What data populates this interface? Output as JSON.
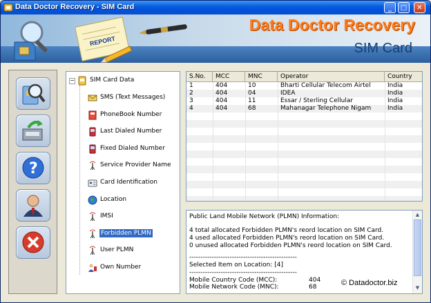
{
  "window": {
    "title": "Data Doctor Recovery - SIM Card",
    "controls": {
      "minimize": "_",
      "maximize": "□",
      "close": "✕"
    }
  },
  "banner": {
    "brand": "Data Doctor Recovery",
    "product": "SIM Card",
    "art_label": "REPORT"
  },
  "toolbar": {
    "buttons": [
      {
        "icon": "sim-search-icon"
      },
      {
        "icon": "save-icon"
      },
      {
        "icon": "help-icon"
      },
      {
        "icon": "user-icon"
      },
      {
        "icon": "exit-icon"
      }
    ]
  },
  "tree": {
    "root": {
      "label": "SIM Card Data",
      "expander": "−"
    },
    "items": [
      {
        "label": "SMS (Text Messages)",
        "icon": "envelope-icon"
      },
      {
        "label": "PhoneBook Number",
        "icon": "phonebook-icon"
      },
      {
        "label": "Last Dialed Number",
        "icon": "phone-icon"
      },
      {
        "label": "Fixed Dialed Number",
        "icon": "phone-icon"
      },
      {
        "label": "Service Provider Name",
        "icon": "antenna-icon"
      },
      {
        "label": "Card Identification",
        "icon": "id-card-icon"
      },
      {
        "label": "Location",
        "icon": "globe-icon"
      },
      {
        "label": "IMSI",
        "icon": "antenna-icon"
      },
      {
        "label": "Forbidden PLMN",
        "icon": "antenna-icon",
        "selected": true
      },
      {
        "label": "User PLMN",
        "icon": "antenna-icon"
      },
      {
        "label": "Own Number",
        "icon": "user-phone-icon"
      }
    ]
  },
  "grid": {
    "columns": [
      "S.No.",
      "MCC",
      "MNC",
      "Operator",
      "Country"
    ],
    "rows": [
      [
        "1",
        "404",
        "10",
        "Bharti Cellular Telecom Airtel",
        "India"
      ],
      [
        "2",
        "404",
        "04",
        "IDEA",
        "India"
      ],
      [
        "3",
        "404",
        "11",
        "Essar / Sterling Cellular",
        "India"
      ],
      [
        "4",
        "404",
        "68",
        "Mahanagar Telephone Nigam",
        "India"
      ]
    ]
  },
  "info": {
    "heading": "Public Land Mobile Network (PLMN) Information:",
    "lines": [
      "4 total allocated Forbidden PLMN's reord location on SIM Card.",
      "4 used allocated Forbidden PLMN's reord location on SIM Card.",
      "0 unused allocated Forbidden PLMN's reord location on SIM Card."
    ],
    "separator": "------------------------------------------------",
    "selected": "Selected Item on Location: [4]",
    "mcc_label": "Mobile Country Code (MCC):",
    "mcc_value": "404",
    "mnc_label": "Mobile Network Code (MNC):",
    "mnc_value": "68",
    "scroll_up": "▲",
    "scroll_down": "▼"
  },
  "footer": {
    "copyright": "© Datadoctor.biz"
  },
  "colors": {
    "accent": "#ff7a18",
    "selection": "#316ac5",
    "titlebar": "#0053e1"
  }
}
